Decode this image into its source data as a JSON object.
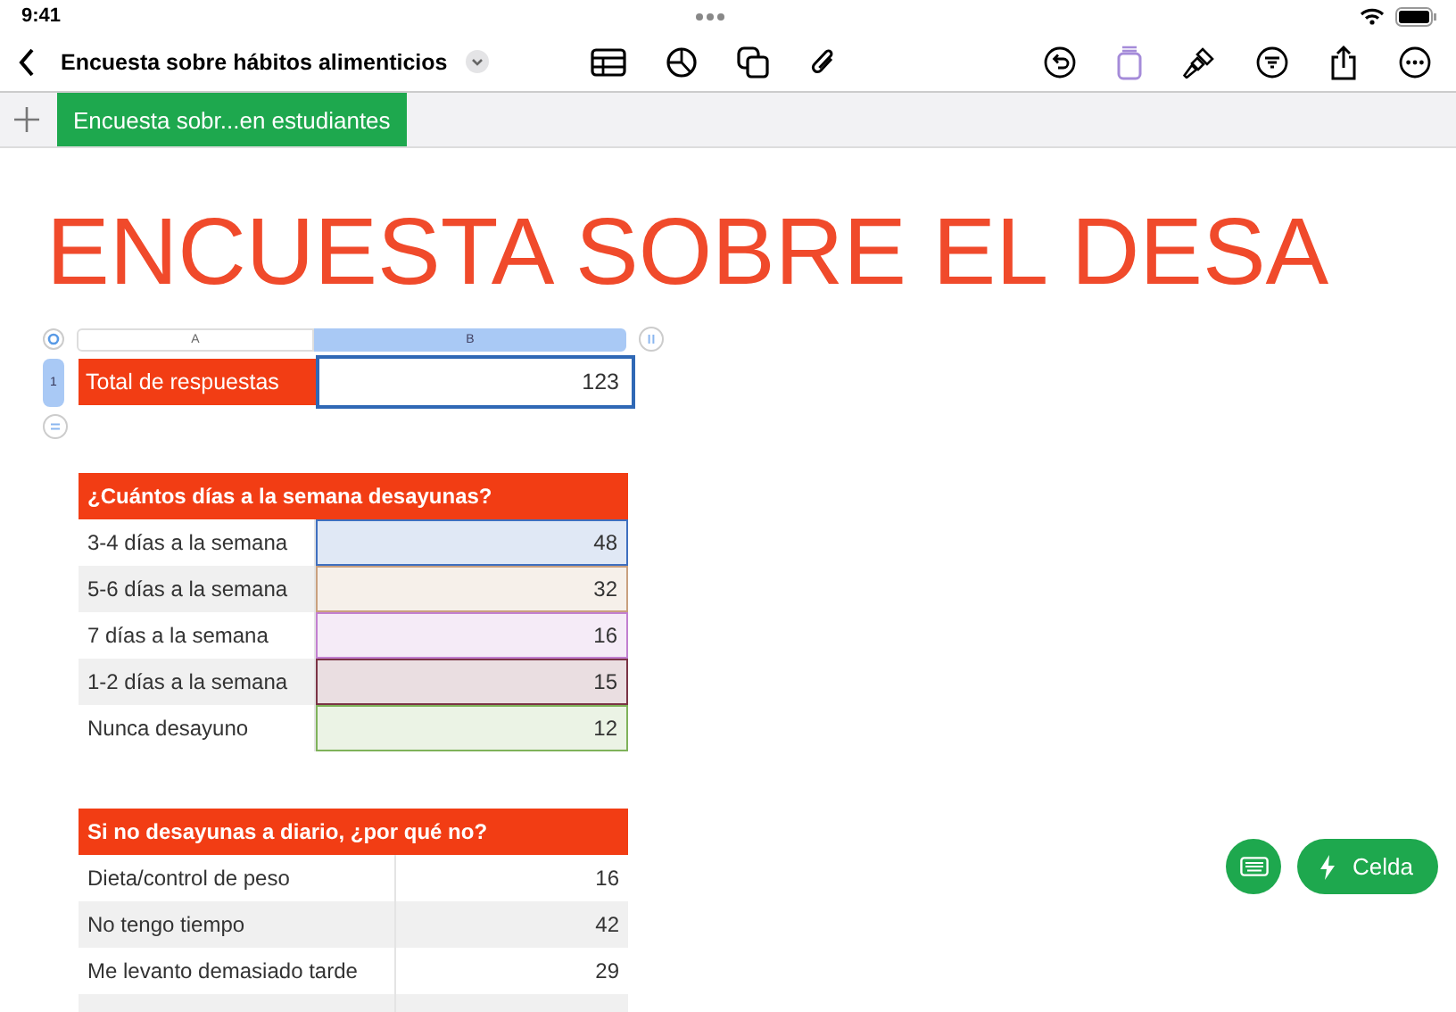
{
  "status_bar": {
    "time": "9:41"
  },
  "toolbar": {
    "title": "Encuesta sobre hábitos alimenticios"
  },
  "sheet_tabs": [
    {
      "label": "Encuesta sobr...en estudiantes",
      "selected": true
    }
  ],
  "page_title": "ENCUESTA SOBRE EL DESA",
  "summary_table": {
    "columns": [
      {
        "label": "A",
        "selected": false
      },
      {
        "label": "B",
        "selected": true
      }
    ],
    "row_header": {
      "label": "1",
      "selected": true
    },
    "label": "Total de respuestas",
    "value": "123"
  },
  "breakfast_table": {
    "title": "¿Cuántos días a la semana desayunas?",
    "rows": [
      {
        "label": "3-4 días a la semana",
        "value": "48",
        "color": "#3f6fbf"
      },
      {
        "label": "5-6 días a la semana",
        "value": "32",
        "color": "#c9a07e"
      },
      {
        "label": "7 días a la semana",
        "value": "16",
        "color": "#c27fd0"
      },
      {
        "label": "1-2 días a la semana",
        "value": "15",
        "color": "#7a3345"
      },
      {
        "label": "Nunca desayuno",
        "value": "12",
        "color": "#7fb25a"
      }
    ]
  },
  "reasons_table": {
    "title": "Si no desayunas a diario, ¿por qué no?",
    "rows": [
      {
        "label": "Dieta/control de peso",
        "value": "16"
      },
      {
        "label": "No tengo tiempo",
        "value": "42"
      },
      {
        "label": "Me levanto demasiado tarde",
        "value": "29"
      }
    ]
  },
  "action_button": {
    "label": "Celda"
  }
}
